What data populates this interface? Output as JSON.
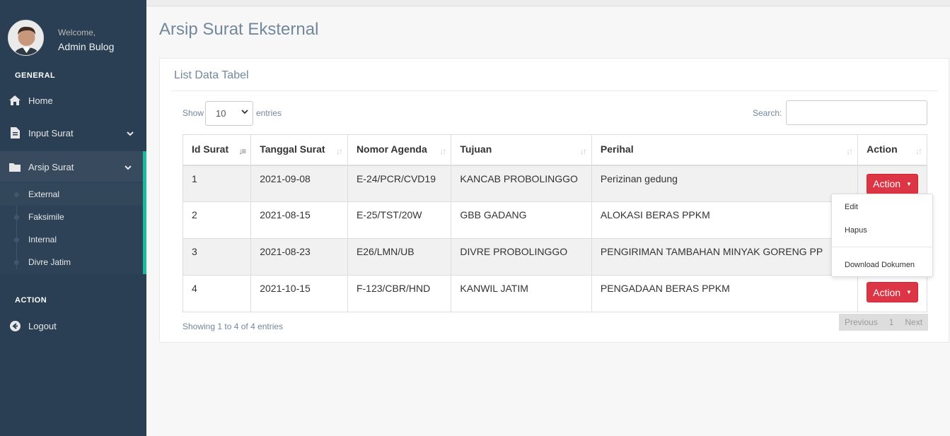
{
  "sidebar": {
    "welcome": "Welcome,",
    "user_name": "Admin Bulog",
    "general_title": "GENERAL",
    "home": "Home",
    "input_surat": "Input Surat",
    "arsip_surat": "Arsip Surat",
    "sub_items": [
      "External",
      "Faksimile",
      "Internal",
      "Divre Jatim"
    ],
    "action_title": "ACTION",
    "logout": "Logout"
  },
  "page": {
    "title": "Arsip Surat Eksternal"
  },
  "panel": {
    "title": "List Data Tabel",
    "show_label": "Show",
    "page_size": "10",
    "entries_label": "entries",
    "search_label": "Search:",
    "search_value": ""
  },
  "table": {
    "headers": [
      "Id Surat",
      "Tanggal Surat",
      "Nomor Agenda",
      "Tujuan",
      "Perihal",
      "Action"
    ],
    "rows": [
      {
        "id": "1",
        "tanggal": "2021-09-08",
        "nomor": "E-24/PCR/CVD19",
        "tujuan": "KANCAB PROBOLINGGO",
        "perihal": "Perizinan gedung"
      },
      {
        "id": "2",
        "tanggal": "2021-08-15",
        "nomor": "E-25/TST/20W",
        "tujuan": "GBB GADANG",
        "perihal": "ALOKASI BERAS PPKM"
      },
      {
        "id": "3",
        "tanggal": "2021-08-23",
        "nomor": "E26/LMN/UB",
        "tujuan": "DIVRE PROBOLINGGO",
        "perihal": "PENGIRIMAN TAMBAHAN MINYAK GORENG PP"
      },
      {
        "id": "4",
        "tanggal": "2021-10-15",
        "nomor": "F-123/CBR/HND",
        "tujuan": "KANWIL JATIM",
        "perihal": "PENGADAAN BERAS PPKM"
      }
    ],
    "action_label": "Action"
  },
  "footer": {
    "info": "Showing 1 to 4 of 4 entries",
    "previous": "Previous",
    "page": "1",
    "next": "Next"
  },
  "dropdown": {
    "edit": "Edit",
    "hapus": "Hapus",
    "download": "Download Dokumen"
  },
  "colors": {
    "sidebar_bg": "#2a3f54",
    "accent": "#1abb9c",
    "action_button": "#dc3545"
  }
}
